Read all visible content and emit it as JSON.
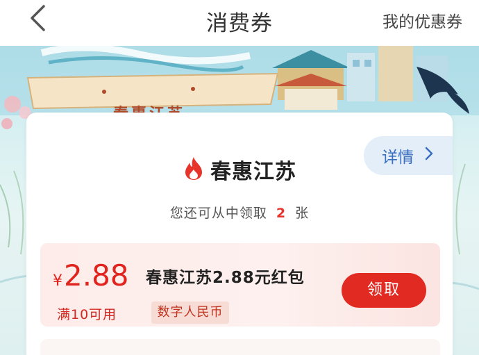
{
  "navbar": {
    "back_icon": "chevron-left-icon",
    "title": "消费券",
    "right_link": "我的优惠券"
  },
  "banner": {
    "slogan": "春惠江苏"
  },
  "card": {
    "detail_label": "详情",
    "detail_icon": "chevron-right-icon",
    "title_icon": "flame-icon",
    "title": "春惠江苏",
    "subtitle_prefix": "您还可从中领取",
    "subtitle_count": "2",
    "subtitle_suffix": "张"
  },
  "coupon": {
    "currency": "¥",
    "amount": "2.88",
    "condition": "满10可用",
    "name": "春惠江苏2.88元红包",
    "tag": "数字人民币",
    "claim_label": "领取"
  },
  "colors": {
    "accent_red": "#e12a22",
    "link_blue": "#3a6fbf"
  }
}
